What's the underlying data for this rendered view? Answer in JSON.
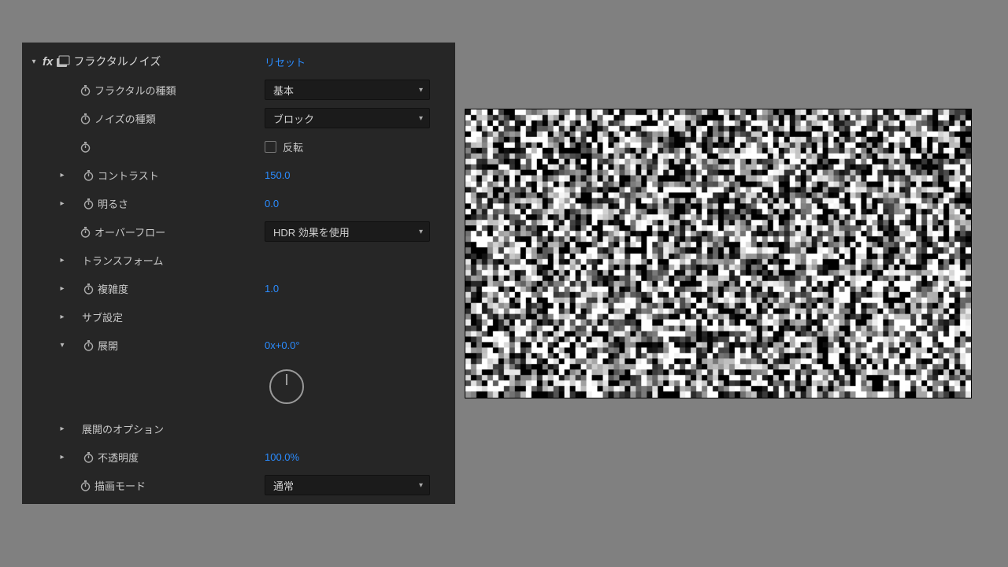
{
  "effect": {
    "fx_label": "fx",
    "name": "フラクタルノイズ",
    "reset": "リセット",
    "rows": {
      "fractal_type": {
        "label": "フラクタルの種類",
        "value": "基本"
      },
      "noise_type": {
        "label": "ノイズの種類",
        "value": "ブロック"
      },
      "invert": {
        "label": "反転"
      },
      "contrast": {
        "label": "コントラスト",
        "value": "150.0"
      },
      "brightness": {
        "label": "明るさ",
        "value": "0.0"
      },
      "overflow": {
        "label": "オーバーフロー",
        "value": "HDR 効果を使用"
      },
      "transform": {
        "label": "トランスフォーム"
      },
      "complexity": {
        "label": "複雑度",
        "value": "1.0"
      },
      "sub": {
        "label": "サブ設定"
      },
      "evolution": {
        "label": "展開",
        "value": "0x+0.0°"
      },
      "evo_options": {
        "label": "展開のオプション"
      },
      "opacity": {
        "label": "不透明度",
        "value": "100.0%"
      },
      "blend": {
        "label": "描画モード",
        "value": "通常"
      }
    }
  },
  "preview": {
    "seed": 7,
    "cols": 92,
    "rows": 52
  }
}
